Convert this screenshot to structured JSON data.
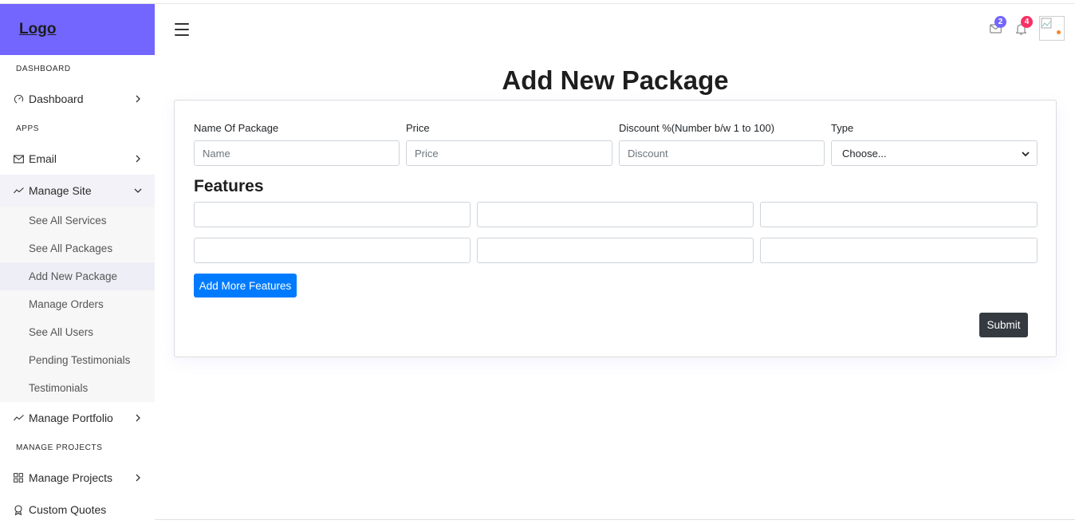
{
  "sidebar": {
    "logo": "Logo",
    "sections": {
      "dashboard": "DASHBOARD",
      "apps": "APPS",
      "manage_projects": "MANAGE PROJECTS"
    },
    "items": {
      "dashboard": "Dashboard",
      "email": "Email",
      "manage_site": "Manage Site",
      "manage_portfolio": "Manage Portfolio",
      "manage_projects": "Manage Projects",
      "custom_quotes": "Custom Quotes"
    },
    "submenu": [
      "See All Services",
      "See All Packages",
      "Add New Package",
      "Manage Orders",
      "See All Users",
      "Pending Testimonials",
      "Testimonials"
    ],
    "active_submenu": "Add New Package"
  },
  "header": {
    "mail_count": "2",
    "notification_count": "4",
    "mail_badge_color": "#7366ff",
    "notification_badge_color": "#f73164"
  },
  "main": {
    "title": "Add New Package",
    "fields": {
      "name_label": "Name Of Package",
      "name_placeholder": "Name",
      "price_label": "Price",
      "price_placeholder": "Price",
      "discount_label": "Discount %(Number b/w 1 to 100)",
      "discount_placeholder": "Discount",
      "type_label": "Type",
      "type_selected": "Choose..."
    },
    "features_title": "Features",
    "add_more_label": "Add More Features",
    "submit_label": "Submit"
  },
  "colors": {
    "accent": "#7366ff",
    "primary_button": "#007bff",
    "dark_button": "#343a40"
  }
}
